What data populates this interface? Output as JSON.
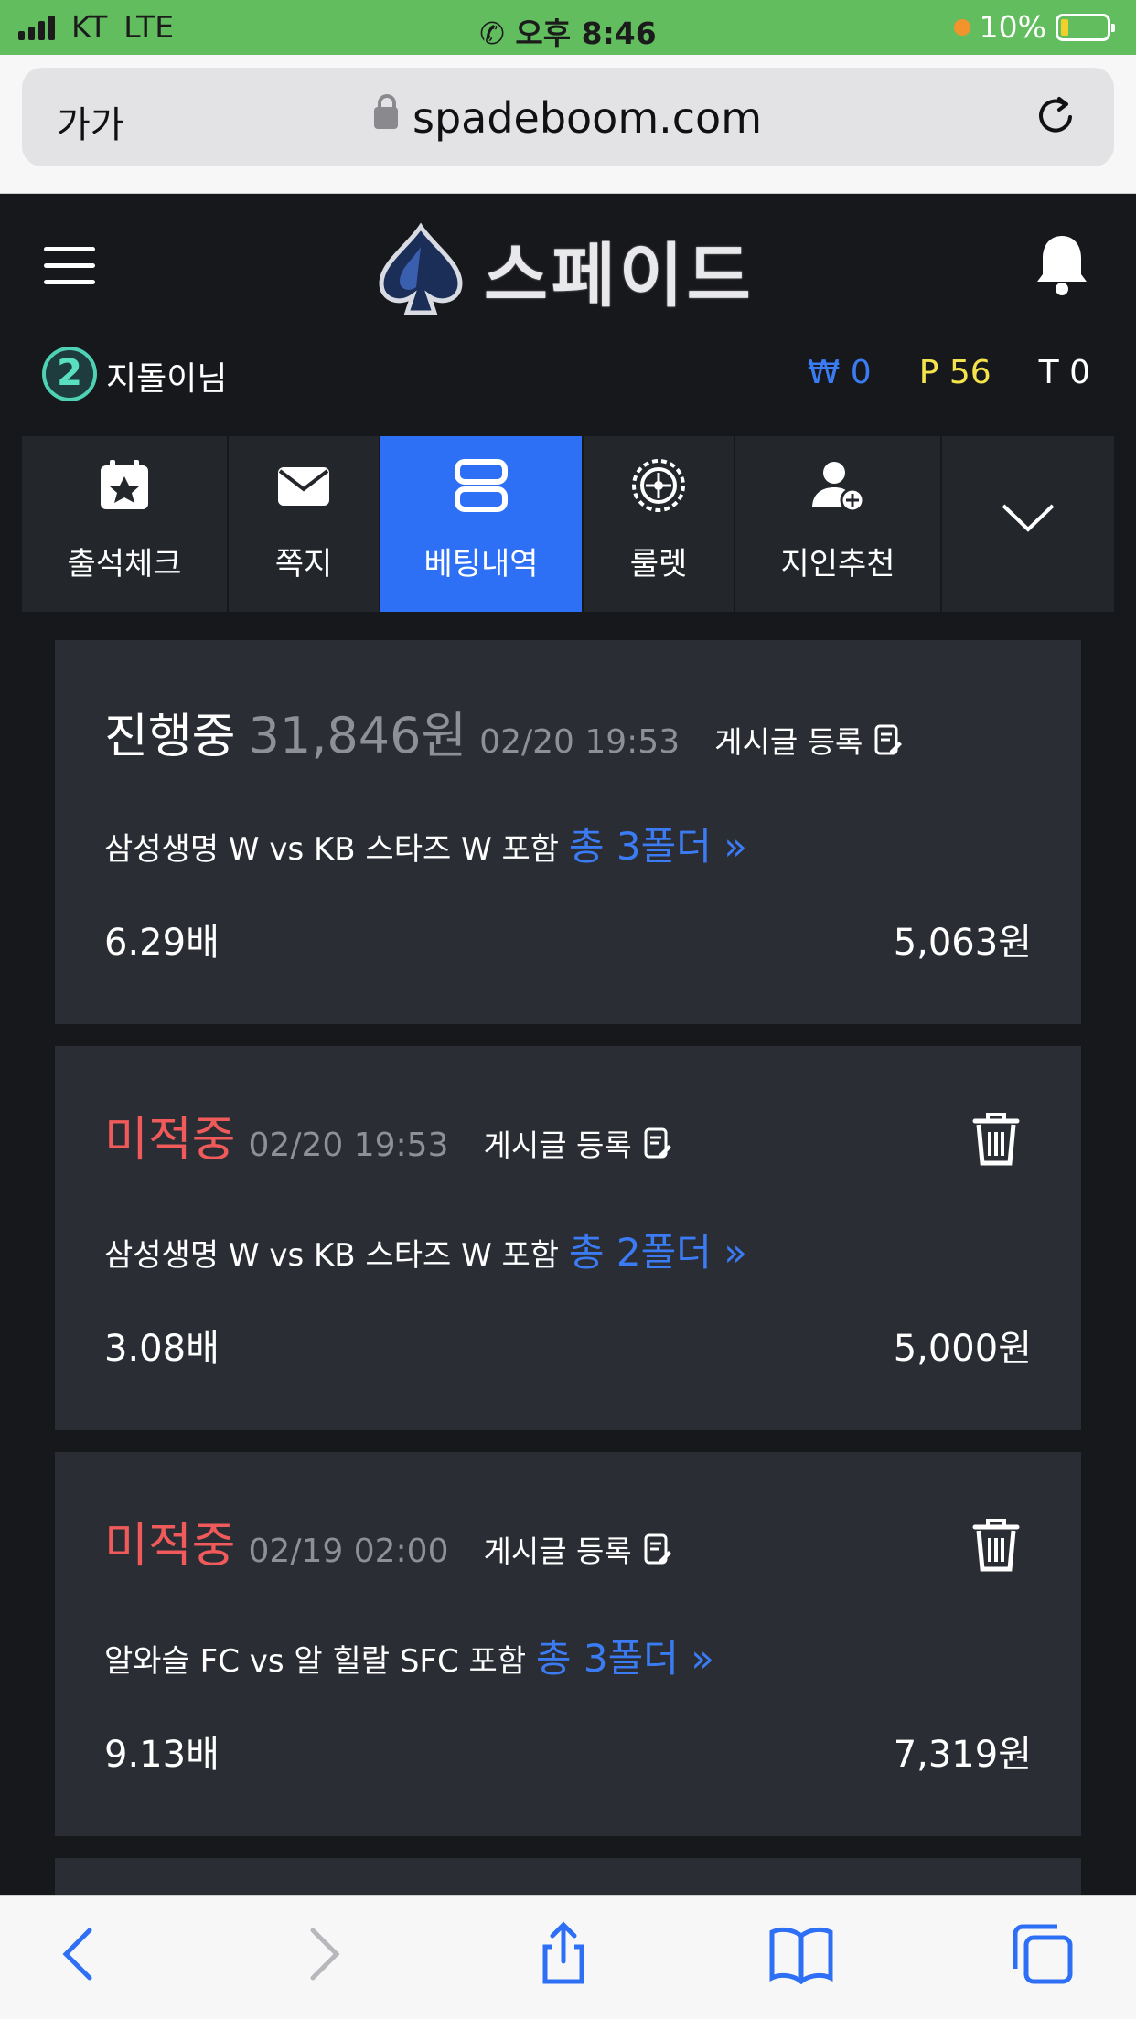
{
  "status_bar": {
    "carrier": "KT",
    "network": "LTE",
    "time": "오후 8:46",
    "battery": "10%"
  },
  "browser": {
    "text_size_label": "가가",
    "url": "spadeboom.com"
  },
  "header": {
    "logo_text": "스페이드"
  },
  "user": {
    "avatar_badge": "2",
    "name": "지돌이님",
    "won": "₩ 0",
    "points": "P 56",
    "tickets": "T 0"
  },
  "tabs": [
    {
      "label": "출석체크",
      "icon": "calendar-star-icon"
    },
    {
      "label": "쪽지",
      "icon": "envelope-icon"
    },
    {
      "label": "베팅내역",
      "icon": "betting-list-icon",
      "active": true
    },
    {
      "label": "룰렛",
      "icon": "roulette-icon"
    },
    {
      "label": "지인추천",
      "icon": "add-user-icon"
    }
  ],
  "bets": [
    {
      "status": "진행중",
      "amount": "31,846원",
      "datetime": "02/20 19:53",
      "post_label": "게시글 등록",
      "match": "삼성생명 W vs KB 스타즈 W 포함",
      "folder": "총 3폴더",
      "odds": "6.29배",
      "win_amount": "5,063원"
    },
    {
      "status": "미적중",
      "datetime": "02/20 19:53",
      "post_label": "게시글 등록",
      "match": "삼성생명 W vs KB 스타즈 W 포함",
      "folder": "총 2폴더",
      "odds": "3.08배",
      "win_amount": "5,000원"
    },
    {
      "status": "미적중",
      "datetime": "02/19 02:00",
      "post_label": "게시글 등록",
      "match": "알와슬 FC vs 알 힐랄 SFC 포함",
      "folder": "총 3폴더",
      "odds": "9.13배",
      "win_amount": "7,319원"
    }
  ],
  "colors": {
    "accent_blue": "#2d6ff5",
    "lost_red": "#f05a5a",
    "points_yellow": "#f4e34c",
    "status_bar_green": "#62bd5f"
  }
}
